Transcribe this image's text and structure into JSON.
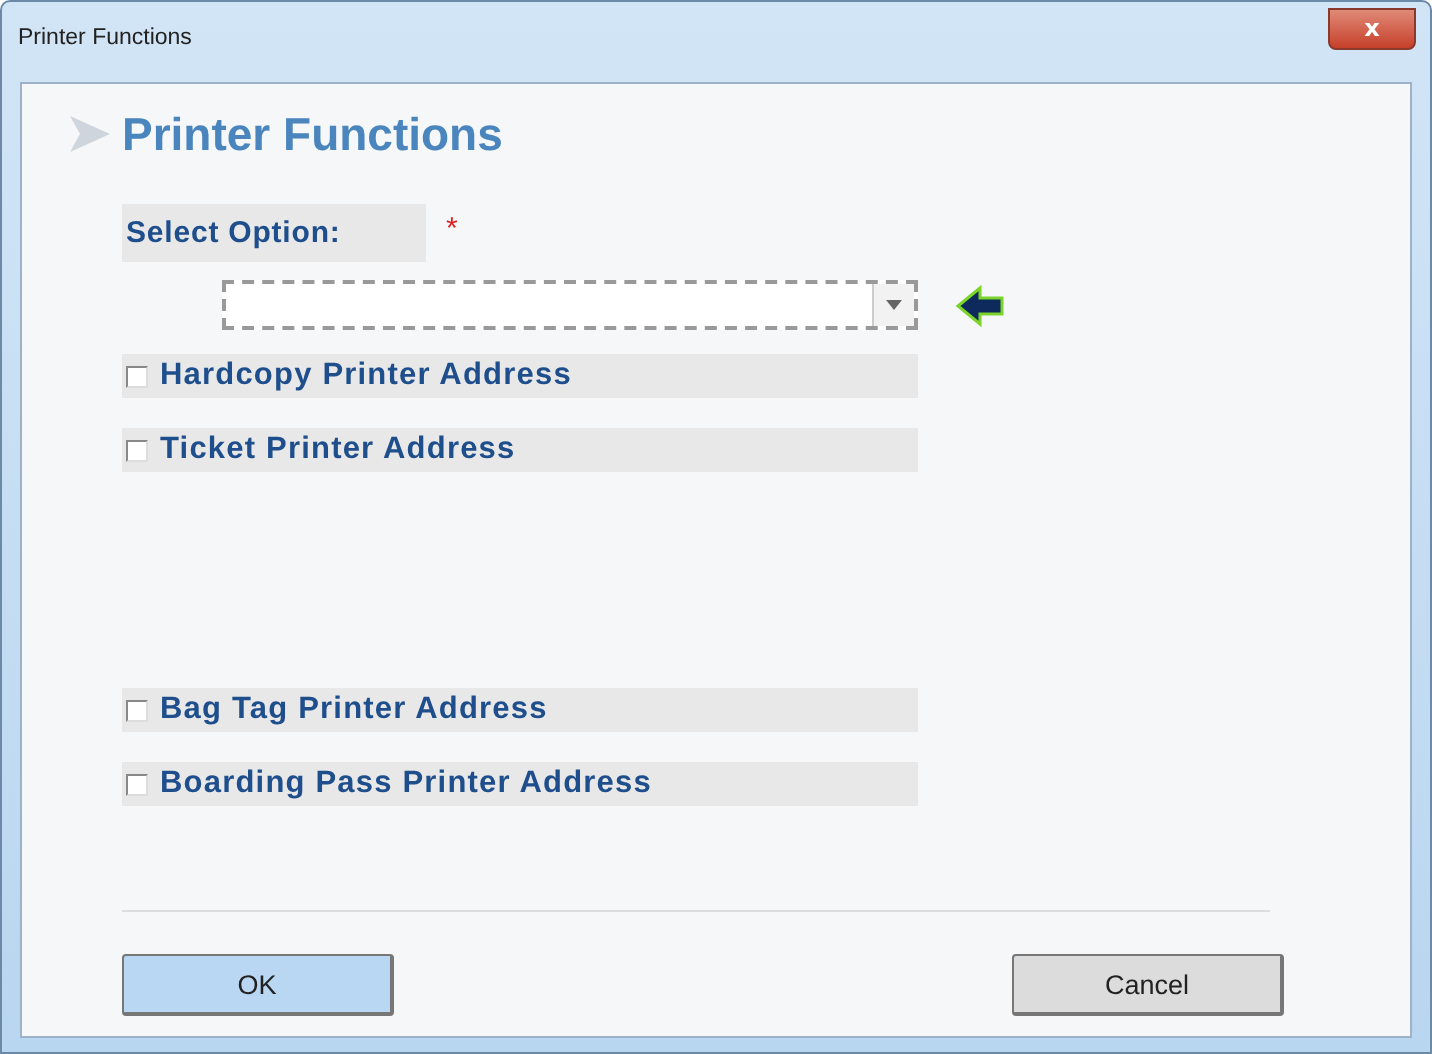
{
  "window": {
    "title": "Printer Functions",
    "close_icon": "x"
  },
  "heading": "Printer Functions",
  "select_option": {
    "label": "Select Option:",
    "required_mark": "*"
  },
  "options": [
    {
      "label": "Hardcopy Printer Address",
      "checked": false
    },
    {
      "label": "Ticket Printer Address",
      "checked": false
    },
    {
      "label": "Bag Tag Printer Address",
      "checked": false
    },
    {
      "label": "Boarding Pass Printer Address",
      "checked": false
    }
  ],
  "buttons": [
    {
      "label": "OK",
      "kind": "primary"
    },
    {
      "label": "Cancel",
      "kind": "secondary"
    }
  ]
}
